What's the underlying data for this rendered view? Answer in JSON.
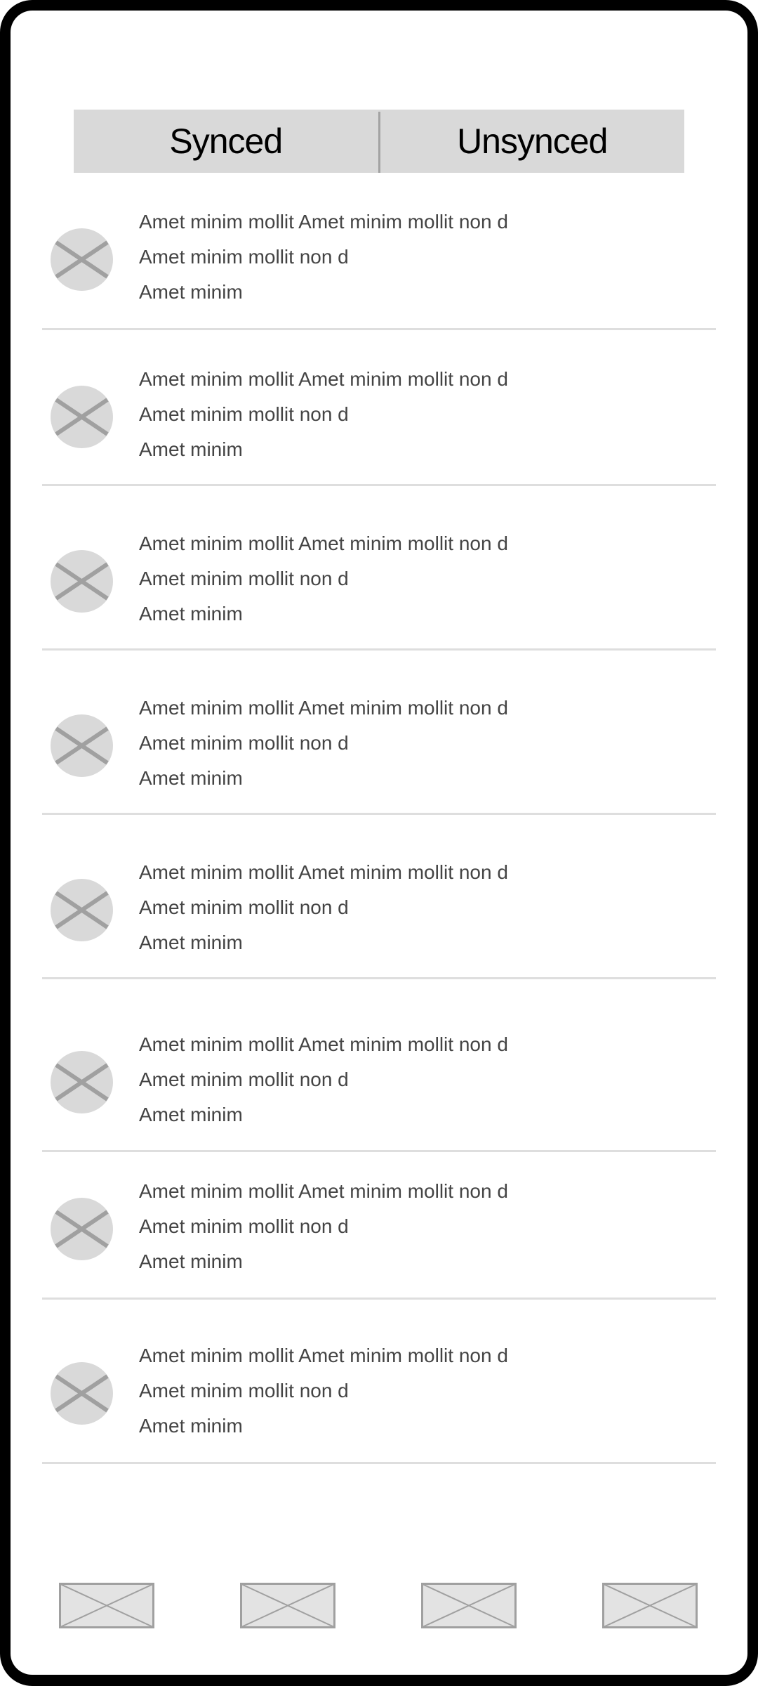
{
  "tabs": [
    {
      "label": "Synced"
    },
    {
      "label": "Unsynced"
    }
  ],
  "list": {
    "items": [
      {
        "lines": [
          "Amet minim mollit Amet minim mollit non d",
          "Amet minim mollit non d",
          "Amet minim"
        ],
        "icon": "image-placeholder-icon"
      },
      {
        "lines": [
          "Amet minim mollit Amet minim mollit non d",
          "Amet minim mollit non d",
          "Amet minim"
        ],
        "icon": "image-placeholder-icon"
      },
      {
        "lines": [
          "Amet minim mollit Amet minim mollit non d",
          "Amet minim mollit non d",
          "Amet minim"
        ],
        "icon": "image-placeholder-icon"
      },
      {
        "lines": [
          "Amet minim mollit Amet minim mollit non d",
          "Amet minim mollit non d",
          "Amet minim"
        ],
        "icon": "image-placeholder-icon"
      },
      {
        "lines": [
          "Amet minim mollit Amet minim mollit non d",
          "Amet minim mollit non d",
          "Amet minim"
        ],
        "icon": "image-placeholder-icon"
      },
      {
        "lines": [
          "Amet minim mollit Amet minim mollit non d",
          "Amet minim mollit non d",
          "Amet minim"
        ],
        "icon": "image-placeholder-icon"
      },
      {
        "lines": [
          "Amet minim mollit Amet minim mollit non d",
          "Amet minim mollit non d",
          "Amet minim"
        ],
        "icon": "image-placeholder-icon"
      },
      {
        "lines": [
          "Amet minim mollit Amet minim mollit non d",
          "Amet minim mollit non d",
          "Amet minim"
        ],
        "icon": "image-placeholder-icon"
      }
    ]
  },
  "bottom_nav": {
    "items": [
      {
        "icon": "image-placeholder-icon"
      },
      {
        "icon": "image-placeholder-icon"
      },
      {
        "icon": "image-placeholder-icon"
      },
      {
        "icon": "image-placeholder-icon"
      }
    ]
  },
  "colors": {
    "frame": "#000000",
    "tab_background": "#d9d9d9",
    "placeholder_fill": "#d9d9d9",
    "placeholder_stroke": "#a0a0a0",
    "separator": "#dedede",
    "text": "#444444"
  }
}
